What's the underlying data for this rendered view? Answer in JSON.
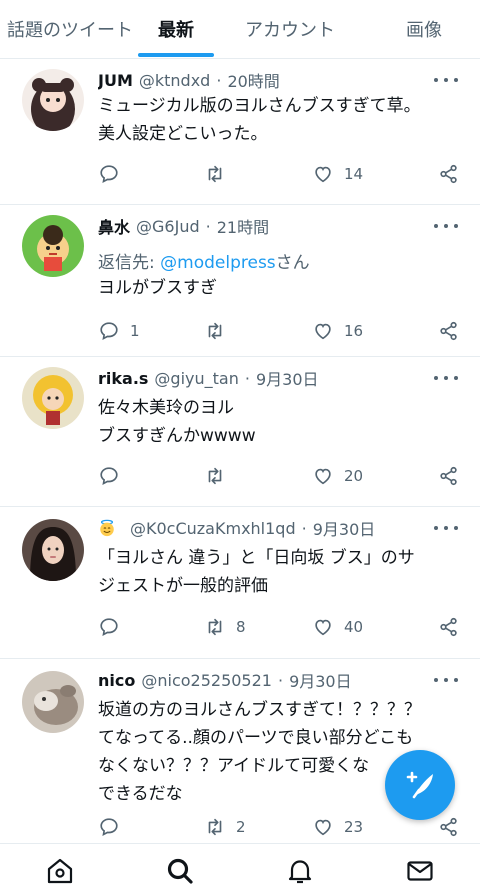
{
  "tabs": [
    {
      "label": "話題のツイート"
    },
    {
      "label": "最新"
    },
    {
      "label": "アカウント"
    },
    {
      "label": "画像"
    }
  ],
  "tweets": [
    {
      "name": "JUM",
      "handle": "@ktndxd",
      "time": "20時間",
      "text": "ミュージカル版のヨルさんブスすぎて草。\n美人設定どこいった。",
      "replies": "",
      "retweets": "",
      "likes": "14"
    },
    {
      "name": "鼻水",
      "handle": "@G6Jud",
      "time": "21時間",
      "reply_prefix": "返信先: ",
      "reply_handle": "@modelpress",
      "reply_suffix": "さん",
      "text": "ヨルがブスすぎ",
      "replies": "1",
      "retweets": "",
      "likes": "16"
    },
    {
      "name": "rika.s",
      "handle": "@giyu_tan",
      "time": "9月30日",
      "text": "佐々木美玲のヨル\nブスすぎんかwwww",
      "replies": "",
      "retweets": "",
      "likes": "20"
    },
    {
      "name": "",
      "handle": "@K0cCuzaKmxhl1qd",
      "time": "9月30日",
      "text": "「ヨルさん 違う」と「日向坂 ブス」のサ\nジェストが一般的評価",
      "replies": "",
      "retweets": "8",
      "likes": "40"
    },
    {
      "name": "nico",
      "handle": "@nico25250521",
      "time": "9月30日",
      "text": "坂道の方のヨルさんブスすぎて！？？？？\nてなってる..顔のパーツで良い部分どこも\nなくない？？？アイドルて可愛くな\nできるだな",
      "replies": "",
      "retweets": "2",
      "likes": "23"
    }
  ],
  "colors": {
    "accent": "#1d9bf0",
    "muted": "#536471",
    "text": "#0f1419"
  },
  "icons": {
    "reply": "reply-icon",
    "retweet": "retweet-icon",
    "like": "heart-icon",
    "share": "share-icon",
    "home": "home-icon",
    "search": "search-icon",
    "notifications": "bell-icon",
    "messages": "mail-icon",
    "compose": "compose-icon"
  }
}
